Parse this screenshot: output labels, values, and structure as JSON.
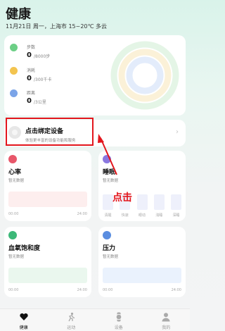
{
  "header": {
    "title": "健康",
    "date": "11月21日 周一，上海市 15~20℃ 多云"
  },
  "activity": {
    "metrics": [
      {
        "name": "步数",
        "value": "0",
        "unit": "/8000步",
        "color": "#6ccf86"
      },
      {
        "name": "消耗",
        "value": "0",
        "unit": "/300千卡",
        "color": "#f3c44f"
      },
      {
        "name": "距离",
        "value": "0",
        "unit": "/3公里",
        "color": "#7ba4e8"
      }
    ]
  },
  "bind": {
    "title": "点击绑定设备",
    "subtitle": "体验更丰富的设备功能和服务"
  },
  "annotation": {
    "label": "点击"
  },
  "tiles": {
    "heart": {
      "title": "心率",
      "status": "暂无数据",
      "tick_left": "00:00",
      "tick_right": "24:00"
    },
    "sleep": {
      "title": "睡眠",
      "status": "暂无数据",
      "labels": [
        "清醒",
        "快速",
        "眼动",
        "浅睡",
        "深睡"
      ]
    },
    "spo2": {
      "title": "血氧饱和度",
      "status": "暂无数据",
      "tick_left": "00:00",
      "tick_right": "24:00"
    },
    "stress": {
      "title": "压力",
      "status": "暂无数据",
      "tick_left": "00:00",
      "tick_right": "24:00"
    }
  },
  "nav": [
    {
      "label": "健康",
      "icon": "heart-icon",
      "active": true
    },
    {
      "label": "运动",
      "icon": "run-icon",
      "active": false
    },
    {
      "label": "设备",
      "icon": "watch-icon",
      "active": false
    },
    {
      "label": "我的",
      "icon": "user-icon",
      "active": false
    }
  ],
  "colors": {
    "accent_red": "#e3161d",
    "heart": "#e8576a",
    "sleep": "#8a78e0",
    "spo2": "#3cb878",
    "stress": "#5a8de0"
  }
}
